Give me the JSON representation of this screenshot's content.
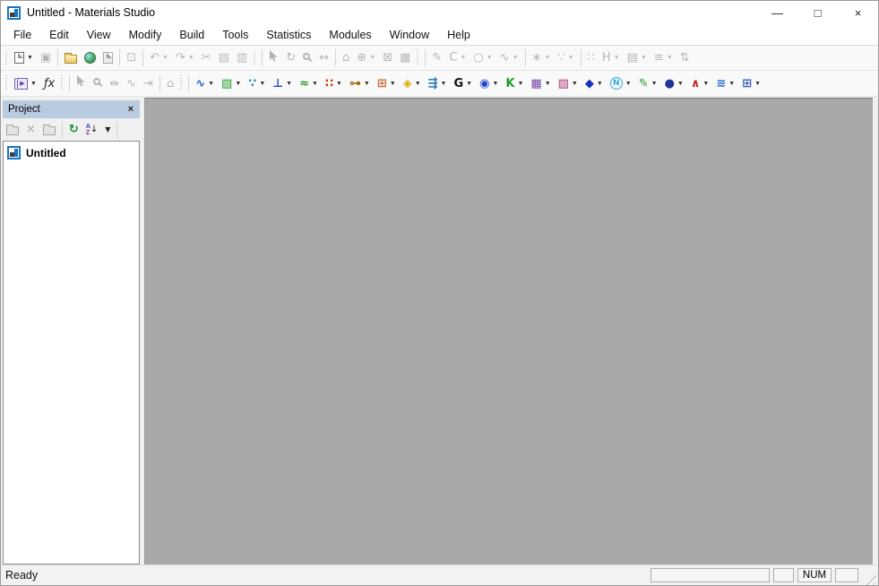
{
  "window": {
    "title": "Untitled - Materials Studio",
    "minimize": "—",
    "maximize": "□",
    "close": "×"
  },
  "menu_bar": {
    "items": [
      "File",
      "Edit",
      "View",
      "Modify",
      "Build",
      "Tools",
      "Statistics",
      "Modules",
      "Window",
      "Help"
    ]
  },
  "toolbars": {
    "row1": [
      {
        "grip": true
      },
      {
        "name": "new-document",
        "icon": {
          "type": "page"
        },
        "enabled": true,
        "dropdown": true
      },
      {
        "name": "save",
        "icon": {
          "glyph": "▣"
        },
        "enabled": false
      },
      {
        "sep": true
      },
      {
        "name": "open",
        "icon": {
          "type": "folder"
        },
        "enabled": true
      },
      {
        "name": "import",
        "icon": {
          "type": "globe"
        },
        "enabled": true
      },
      {
        "name": "export",
        "icon": {
          "type": "page",
          "gray": true
        },
        "enabled": false
      },
      {
        "sep": true
      },
      {
        "name": "viewer",
        "icon": {
          "glyph": "⊡"
        },
        "enabled": false
      },
      {
        "sep": true
      },
      {
        "name": "undo",
        "icon": {
          "glyph": "↶"
        },
        "enabled": false,
        "dropdown": true
      },
      {
        "name": "redo",
        "icon": {
          "glyph": "↷"
        },
        "enabled": false,
        "dropdown": true
      },
      {
        "name": "cut",
        "icon": {
          "glyph": "✂"
        },
        "enabled": false
      },
      {
        "name": "copy",
        "icon": {
          "glyph": "▤"
        },
        "enabled": false
      },
      {
        "name": "paste",
        "icon": {
          "glyph": "▥"
        },
        "enabled": false
      },
      {
        "grip": true
      },
      {
        "sep": true
      },
      {
        "name": "selection-mode",
        "icon": {
          "type": "cursor"
        },
        "enabled": false
      },
      {
        "name": "rotate-mode",
        "icon": {
          "glyph": "↻"
        },
        "enabled": false
      },
      {
        "name": "zoom-mode",
        "icon": {
          "type": "magnifier"
        },
        "enabled": false
      },
      {
        "name": "translate-mode",
        "icon": {
          "glyph": "↔"
        },
        "enabled": false
      },
      {
        "sep": true
      },
      {
        "name": "reset-view",
        "icon": {
          "glyph": "⌂"
        },
        "enabled": false
      },
      {
        "name": "center-view",
        "icon": {
          "glyph": "⊕"
        },
        "enabled": false,
        "dropdown": true
      },
      {
        "name": "fit-view",
        "icon": {
          "glyph": "⊠"
        },
        "enabled": false
      },
      {
        "name": "view-style",
        "icon": {
          "glyph": "▦"
        },
        "enabled": false
      },
      {
        "grip": true
      },
      {
        "sep": true
      },
      {
        "name": "sketch-atom",
        "icon": {
          "glyph": "✎"
        },
        "enabled": false
      },
      {
        "name": "sketch-arc",
        "icon": {
          "glyph": "C"
        },
        "enabled": false,
        "dropdown": true
      },
      {
        "name": "sketch-ring",
        "icon": {
          "glyph": "○"
        },
        "enabled": false,
        "dropdown": true
      },
      {
        "name": "sketch-line",
        "icon": {
          "glyph": "∿"
        },
        "enabled": false,
        "dropdown": true
      },
      {
        "sep": true
      },
      {
        "name": "element-tool",
        "icon": {
          "glyph": "∗"
        },
        "enabled": false,
        "dropdown": true
      },
      {
        "name": "add-atom-tool",
        "icon": {
          "glyph": "∵"
        },
        "enabled": false,
        "dropdown": true
      },
      {
        "sep": true
      },
      {
        "name": "adjust-hydrogen",
        "icon": {
          "glyph": "∷"
        },
        "enabled": false
      },
      {
        "name": "hydrogen-tool",
        "icon": {
          "glyph": "H"
        },
        "enabled": false,
        "dropdown": true
      },
      {
        "name": "sheet-tool",
        "icon": {
          "glyph": "▤"
        },
        "enabled": false,
        "dropdown": true
      },
      {
        "name": "line-style-tool",
        "icon": {
          "glyph": "≡"
        },
        "enabled": false,
        "dropdown": true
      },
      {
        "name": "move-tool",
        "icon": {
          "glyph": "⇅"
        },
        "enabled": false
      }
    ],
    "row2": [
      {
        "grip": true
      },
      {
        "name": "chart-viewer",
        "icon": {
          "type": "player"
        },
        "enabled": true,
        "dropdown": true
      },
      {
        "name": "function-tool",
        "icon": {
          "glyph": "ƒx",
          "color": "#222222",
          "italic": true
        },
        "enabled": true
      },
      {
        "grip": true
      },
      {
        "sep": true
      },
      {
        "name": "selection-mode",
        "icon": {
          "type": "cursor"
        },
        "enabled": false
      },
      {
        "name": "zoom-mode",
        "icon": {
          "type": "magnifier"
        },
        "enabled": false
      },
      {
        "name": "translate-mode",
        "icon": {
          "glyph": "⇹"
        },
        "enabled": false
      },
      {
        "name": "spectrum-tool",
        "icon": {
          "glyph": "∿"
        },
        "enabled": false
      },
      {
        "name": "align-tool",
        "icon": {
          "glyph": "⇥"
        },
        "enabled": false
      },
      {
        "sep": true
      },
      {
        "name": "reset-view",
        "icon": {
          "glyph": "⌂"
        },
        "enabled": false
      },
      {
        "grip": true
      },
      {
        "sep": true
      },
      {
        "name": "polymer-builder",
        "icon": {
          "glyph": "∿",
          "color": "#1a66cc",
          "bold": true
        },
        "enabled": true,
        "dropdown": true
      },
      {
        "name": "crystal-builder",
        "icon": {
          "glyph": "▧",
          "color": "#1f9d2a"
        },
        "enabled": true,
        "dropdown": true
      },
      {
        "name": "nanostructure-builder",
        "icon": {
          "glyph": "∵",
          "color": "#2288cc",
          "bold": true
        },
        "enabled": true,
        "dropdown": true
      },
      {
        "name": "mesostructure-builder",
        "icon": {
          "glyph": "⊥",
          "color": "#2244cc",
          "bold": true
        },
        "enabled": true,
        "dropdown": true
      },
      {
        "name": "amorphous-cell",
        "icon": {
          "glyph": "≈",
          "color": "#1f9d2a",
          "bold": true
        },
        "enabled": true,
        "dropdown": true
      },
      {
        "name": "mesocite-module",
        "icon": {
          "glyph": "∷",
          "color": "#cc3300",
          "bold": true
        },
        "enabled": true,
        "dropdown": true
      },
      {
        "name": "measure-tool",
        "icon": {
          "glyph": "⊶",
          "color": "#996600",
          "bold": true
        },
        "enabled": true,
        "dropdown": true
      },
      {
        "name": "dftb-module",
        "icon": {
          "glyph": "⊞",
          "color": "#cc6633",
          "bold": true
        },
        "enabled": true,
        "dropdown": true
      },
      {
        "name": "packing-module",
        "icon": {
          "glyph": "◈",
          "color": "#ddaa00"
        },
        "enabled": true,
        "dropdown": true
      },
      {
        "name": "vector-tool",
        "icon": {
          "glyph": "⇶",
          "color": "#2277bb",
          "bold": true
        },
        "enabled": true,
        "dropdown": true
      },
      {
        "name": "symmetry-tool",
        "icon": {
          "glyph": "G",
          "color": "#111111",
          "bold": true
        },
        "enabled": true,
        "dropdown": true
      },
      {
        "name": "conformer-tool",
        "icon": {
          "glyph": "◉",
          "color": "#2244cc"
        },
        "enabled": true,
        "dropdown": true
      },
      {
        "name": "castep-module",
        "icon": {
          "glyph": "K",
          "color": "#1f9d2a",
          "bold": true
        },
        "enabled": true,
        "dropdown": true
      },
      {
        "name": "dmol-module",
        "icon": {
          "glyph": "▦",
          "color": "#7744aa"
        },
        "enabled": true,
        "dropdown": true
      },
      {
        "name": "morphology-module",
        "icon": {
          "glyph": "▨",
          "color": "#aa3377"
        },
        "enabled": true,
        "dropdown": true
      },
      {
        "name": "gem-module",
        "icon": {
          "glyph": "◆",
          "color": "#1133bb"
        },
        "enabled": true,
        "dropdown": true
      },
      {
        "name": "n-module",
        "icon": {
          "glyph": "N",
          "color": "#33aadd",
          "bold": true,
          "ring": true
        },
        "enabled": true,
        "dropdown": true
      },
      {
        "name": "sorption-module",
        "icon": {
          "glyph": "✎",
          "color": "#1f9d2a"
        },
        "enabled": true,
        "dropdown": true
      },
      {
        "name": "kinetics-module",
        "icon": {
          "glyph": "●",
          "color": "#223399"
        },
        "enabled": true,
        "dropdown": true
      },
      {
        "name": "spectrum-module",
        "icon": {
          "glyph": "∧",
          "color": "#cc2222",
          "bold": true
        },
        "enabled": true,
        "dropdown": true
      },
      {
        "name": "qsar-module",
        "icon": {
          "glyph": "≋",
          "color": "#2266cc",
          "bold": true
        },
        "enabled": true,
        "dropdown": true
      },
      {
        "name": "table-module",
        "icon": {
          "glyph": "⊞",
          "color": "#3355bb",
          "bold": true
        },
        "enabled": true,
        "dropdown": true
      }
    ]
  },
  "project_panel": {
    "title": "Project",
    "close_label": "×",
    "toolbar": [
      {
        "name": "new-item",
        "icon": {
          "type": "folder",
          "gray": true
        },
        "enabled": false
      },
      {
        "name": "delete-item",
        "icon": {
          "glyph": "×",
          "bold": true
        },
        "enabled": false
      },
      {
        "name": "new-folder",
        "icon": {
          "type": "folder",
          "gray": true
        },
        "enabled": false
      },
      {
        "sep": true
      },
      {
        "name": "refresh",
        "icon": {
          "glyph": "↻",
          "color": "#18922b",
          "bold": true
        },
        "enabled": true
      },
      {
        "name": "sort-items",
        "icon": {
          "type": "az",
          "letters": [
            "A",
            "Z"
          ],
          "arrow": "↓"
        },
        "enabled": true
      },
      {
        "name": "sort-options",
        "icon": {
          "glyph": "▼",
          "color": "#222222",
          "small": true
        },
        "enabled": true
      },
      {
        "sep": true
      }
    ],
    "tree": [
      {
        "label": "Untitled",
        "icon": "materials-studio-logo"
      }
    ]
  },
  "status_bar": {
    "message": "Ready",
    "indicators": [
      "",
      "",
      "NUM",
      ""
    ]
  },
  "colors": {
    "canvas": "#a9a9a9",
    "panel_header": "#b9cbdf",
    "disabled_icon": "#b4b4b4",
    "logo_blue": "#1b74bc"
  }
}
